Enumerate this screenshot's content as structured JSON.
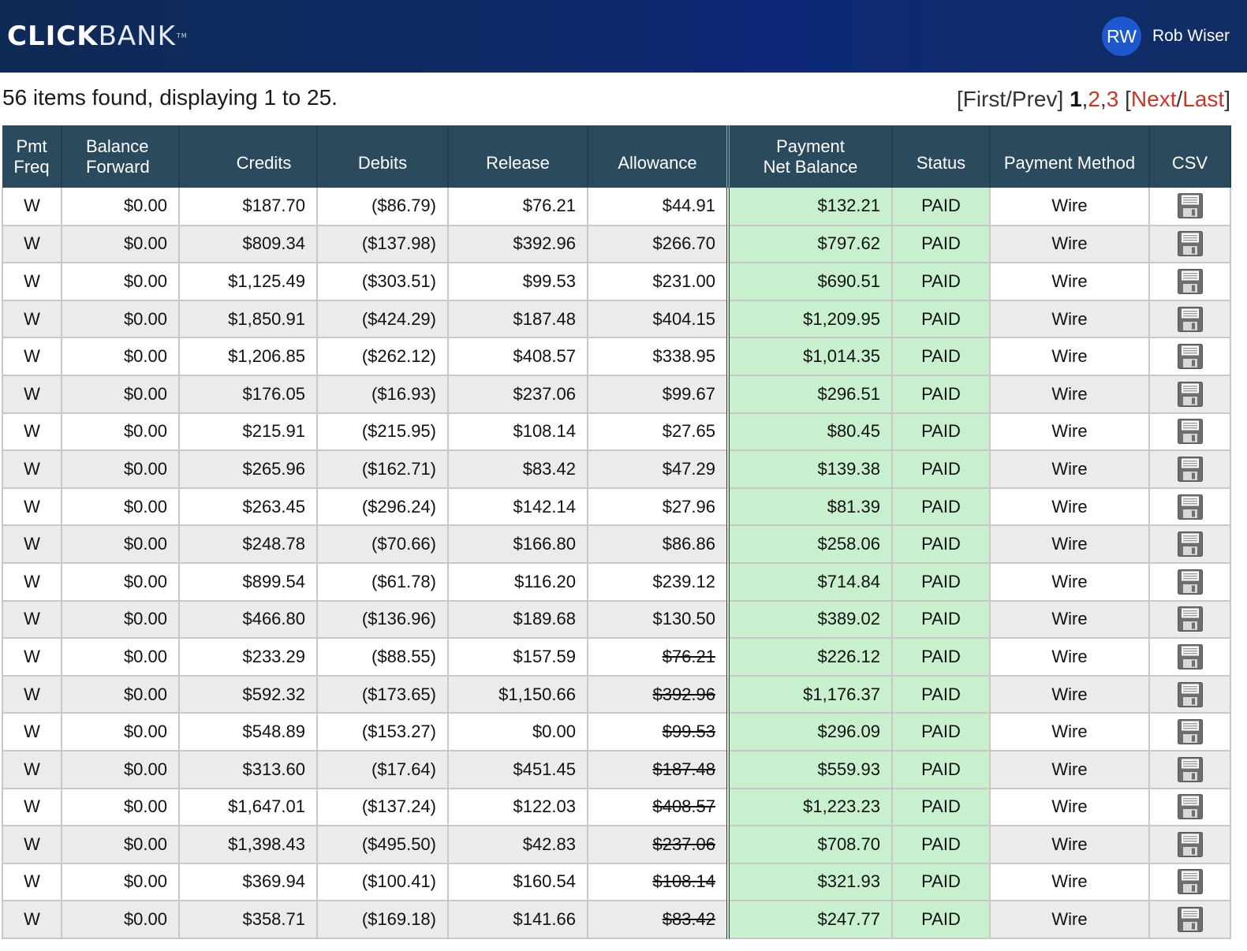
{
  "header": {
    "logo_bold": "CLICK",
    "logo_light": "BANK",
    "logo_tm": "TM",
    "user_initials": "RW",
    "user_name": "Rob Wiser"
  },
  "summary": "56 items found, displaying 1 to 25.",
  "pager": {
    "open": "[",
    "first_prev": "First/Prev",
    "mid": "] ",
    "current": "1",
    "comma1": ",",
    "page2": "2",
    "comma2": ",",
    "page3": "3",
    "bracket": " [",
    "next": "Next",
    "slash": "/",
    "last": "Last",
    "close": "]"
  },
  "columns": {
    "freq_1": "Pmt",
    "freq_2": "Freq",
    "balance_1": "Balance",
    "balance_2": "Forward",
    "credits": "Credits",
    "debits": "Debits",
    "release": "Release",
    "allowance": "Allowance",
    "net_1": "Payment",
    "net_2": "Net Balance",
    "status": "Status",
    "method": "Payment Method",
    "csv": "CSV"
  },
  "icons": {
    "csv": "floppy-disk-save-icon"
  },
  "colors": {
    "header_bg": "#2b4a5d",
    "topbar": "#0c2877",
    "net_bg": "#c8f0ce",
    "link_red": "#c0392b"
  },
  "rows": [
    {
      "freq": "W",
      "balance": "$0.00",
      "credits": "$187.70",
      "debits": "($86.79)",
      "release": "$76.21",
      "allowance": "$44.91",
      "allowance_struck": false,
      "net": "$132.21",
      "status": "PAID",
      "method": "Wire"
    },
    {
      "freq": "W",
      "balance": "$0.00",
      "credits": "$809.34",
      "debits": "($137.98)",
      "release": "$392.96",
      "allowance": "$266.70",
      "allowance_struck": false,
      "net": "$797.62",
      "status": "PAID",
      "method": "Wire"
    },
    {
      "freq": "W",
      "balance": "$0.00",
      "credits": "$1,125.49",
      "debits": "($303.51)",
      "release": "$99.53",
      "allowance": "$231.00",
      "allowance_struck": false,
      "net": "$690.51",
      "status": "PAID",
      "method": "Wire"
    },
    {
      "freq": "W",
      "balance": "$0.00",
      "credits": "$1,850.91",
      "debits": "($424.29)",
      "release": "$187.48",
      "allowance": "$404.15",
      "allowance_struck": false,
      "net": "$1,209.95",
      "status": "PAID",
      "method": "Wire"
    },
    {
      "freq": "W",
      "balance": "$0.00",
      "credits": "$1,206.85",
      "debits": "($262.12)",
      "release": "$408.57",
      "allowance": "$338.95",
      "allowance_struck": false,
      "net": "$1,014.35",
      "status": "PAID",
      "method": "Wire"
    },
    {
      "freq": "W",
      "balance": "$0.00",
      "credits": "$176.05",
      "debits": "($16.93)",
      "release": "$237.06",
      "allowance": "$99.67",
      "allowance_struck": false,
      "net": "$296.51",
      "status": "PAID",
      "method": "Wire"
    },
    {
      "freq": "W",
      "balance": "$0.00",
      "credits": "$215.91",
      "debits": "($215.95)",
      "release": "$108.14",
      "allowance": "$27.65",
      "allowance_struck": false,
      "net": "$80.45",
      "status": "PAID",
      "method": "Wire"
    },
    {
      "freq": "W",
      "balance": "$0.00",
      "credits": "$265.96",
      "debits": "($162.71)",
      "release": "$83.42",
      "allowance": "$47.29",
      "allowance_struck": false,
      "net": "$139.38",
      "status": "PAID",
      "method": "Wire"
    },
    {
      "freq": "W",
      "balance": "$0.00",
      "credits": "$263.45",
      "debits": "($296.24)",
      "release": "$142.14",
      "allowance": "$27.96",
      "allowance_struck": false,
      "net": "$81.39",
      "status": "PAID",
      "method": "Wire"
    },
    {
      "freq": "W",
      "balance": "$0.00",
      "credits": "$248.78",
      "debits": "($70.66)",
      "release": "$166.80",
      "allowance": "$86.86",
      "allowance_struck": false,
      "net": "$258.06",
      "status": "PAID",
      "method": "Wire"
    },
    {
      "freq": "W",
      "balance": "$0.00",
      "credits": "$899.54",
      "debits": "($61.78)",
      "release": "$116.20",
      "allowance": "$239.12",
      "allowance_struck": false,
      "net": "$714.84",
      "status": "PAID",
      "method": "Wire"
    },
    {
      "freq": "W",
      "balance": "$0.00",
      "credits": "$466.80",
      "debits": "($136.96)",
      "release": "$189.68",
      "allowance": "$130.50",
      "allowance_struck": false,
      "net": "$389.02",
      "status": "PAID",
      "method": "Wire"
    },
    {
      "freq": "W",
      "balance": "$0.00",
      "credits": "$233.29",
      "debits": "($88.55)",
      "release": "$157.59",
      "allowance": "$76.21",
      "allowance_struck": true,
      "net": "$226.12",
      "status": "PAID",
      "method": "Wire"
    },
    {
      "freq": "W",
      "balance": "$0.00",
      "credits": "$592.32",
      "debits": "($173.65)",
      "release": "$1,150.66",
      "allowance": "$392.96",
      "allowance_struck": true,
      "net": "$1,176.37",
      "status": "PAID",
      "method": "Wire"
    },
    {
      "freq": "W",
      "balance": "$0.00",
      "credits": "$548.89",
      "debits": "($153.27)",
      "release": "$0.00",
      "allowance": "$99.53",
      "allowance_struck": true,
      "net": "$296.09",
      "status": "PAID",
      "method": "Wire"
    },
    {
      "freq": "W",
      "balance": "$0.00",
      "credits": "$313.60",
      "debits": "($17.64)",
      "release": "$451.45",
      "allowance": "$187.48",
      "allowance_struck": true,
      "net": "$559.93",
      "status": "PAID",
      "method": "Wire"
    },
    {
      "freq": "W",
      "balance": "$0.00",
      "credits": "$1,647.01",
      "debits": "($137.24)",
      "release": "$122.03",
      "allowance": "$408.57",
      "allowance_struck": true,
      "net": "$1,223.23",
      "status": "PAID",
      "method": "Wire"
    },
    {
      "freq": "W",
      "balance": "$0.00",
      "credits": "$1,398.43",
      "debits": "($495.50)",
      "release": "$42.83",
      "allowance": "$237.06",
      "allowance_struck": true,
      "net": "$708.70",
      "status": "PAID",
      "method": "Wire"
    },
    {
      "freq": "W",
      "balance": "$0.00",
      "credits": "$369.94",
      "debits": "($100.41)",
      "release": "$160.54",
      "allowance": "$108.14",
      "allowance_struck": true,
      "net": "$321.93",
      "status": "PAID",
      "method": "Wire"
    },
    {
      "freq": "W",
      "balance": "$0.00",
      "credits": "$358.71",
      "debits": "($169.18)",
      "release": "$141.66",
      "allowance": "$83.42",
      "allowance_struck": true,
      "net": "$247.77",
      "status": "PAID",
      "method": "Wire"
    }
  ]
}
